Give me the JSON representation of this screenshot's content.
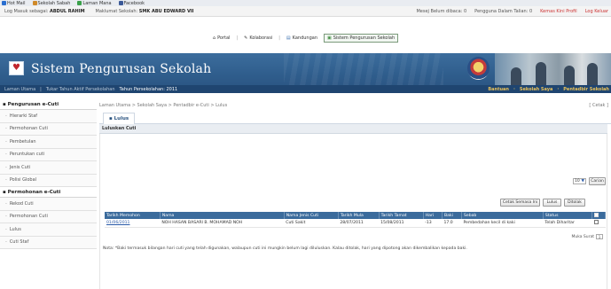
{
  "bookmarks": [
    {
      "label": "Hot Mail",
      "color": "#2a6fd0"
    },
    {
      "label": "Sekolah Sabah",
      "color": "#d08a2a"
    },
    {
      "label": "Laman Mana",
      "color": "#3aa04a"
    },
    {
      "label": "Facebook",
      "color": "#3b5998"
    }
  ],
  "infobar": {
    "login_prefix": "Log Masuk sebagai:",
    "user": "ABDUL RAHIM",
    "school_prefix": "Maklumat Sekolah:",
    "school": "SMK ABU EDWARD VII",
    "mail": "Mesej Belum dibaca: 0",
    "online": "Pengguna Dalam Talian: 0",
    "profile": "Kemas Kini Profil",
    "logout": "Log Keluar"
  },
  "portal_nav": [
    {
      "label": "Portal",
      "icon": "home-icon"
    },
    {
      "label": "Kolaborasi",
      "icon": "pencil-icon"
    },
    {
      "label": "Kandungan",
      "icon": "folder-icon"
    },
    {
      "label": "Sistem Pengurusan Sekolah",
      "icon": "app-icon",
      "active": true
    }
  ],
  "banner": {
    "title": "Sistem Pengurusan Sekolah"
  },
  "menubar": {
    "home": "Laman Utama",
    "academic_year_label": "Tukar Tahun Aktif Persekolahan",
    "academic_year": "Tahun Persekolahan: 2011",
    "help": "Bantuan",
    "my_school": "Sekolah Saya",
    "admin": "Pentadbir Sekolah"
  },
  "sidebar": {
    "section1": "Pengurusan e-Cuti",
    "items1": [
      "Hierarki Staf",
      "Permohonan Cuti",
      "Pembetulan",
      "Peruntukan cuti",
      "Jenis Cuti",
      "Polisi Global"
    ],
    "section2": "Permohonan e-Cuti",
    "items2": [
      "Rekod Cuti",
      "Permohonan Cuti",
      "Lulus",
      "Cuti Staf"
    ]
  },
  "main": {
    "breadcrumb": "Laman Utama > Sekolah Saya > Pentadbir e-Cuti > Lulus",
    "print": "[ Cetak ]",
    "tab": "Lulus",
    "section_title": "Luluskan Cuti",
    "page_size": "10",
    "btn_carian": "Carian",
    "btn_cetak_semasa": "Cetak Semasa Ini",
    "btn_lulus": "Lulus",
    "btn_ditolak": "Ditolak",
    "page_label": "Muka Surat",
    "page_value": "1",
    "note": "Nota: *Baki termasuk bilangan hari cuti yang telah digunakan, walaupun cuti ini mungkin belum lagi diluluskan. Kalau ditolak, hari yang dipotong akan dikembalikan kepada baki."
  },
  "table": {
    "headers": [
      "Tarikh Memohon",
      "Nama",
      "Nama Jenis Cuti",
      "Tarikh Mula",
      "Tarikh Tamat",
      "Hari",
      "Baki",
      "Sebab",
      "Status"
    ],
    "rows": [
      [
        "01/06/2011",
        "NOH HASAN BASARI B. MOHAMAD NOH",
        "Cuti Sakit",
        "28/07/2011",
        "15/08/2011",
        "-13",
        "17.0",
        "Pembedahan kecil di kaki",
        "Telah Diharitar"
      ]
    ]
  }
}
